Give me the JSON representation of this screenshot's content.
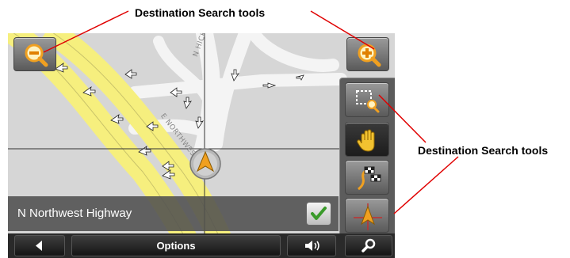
{
  "callouts": {
    "top": "Destination Search tools",
    "right": "Destination Search tools"
  },
  "map": {
    "street_labels": [
      "N HICKORY",
      "E NORTHWEST HWY"
    ]
  },
  "buttons": {
    "zoom_out_icon": "zoom-out-magnifier-icon",
    "zoom_in_icon": "zoom-in-magnifier-icon",
    "tools": [
      {
        "icon": "area-select-icon"
      },
      {
        "icon": "hand-pan-icon",
        "active": true
      },
      {
        "icon": "route-flags-icon"
      },
      {
        "icon": "current-position-icon"
      }
    ]
  },
  "street_bar": {
    "name": "N Northwest Highway",
    "confirm_icon": "checkmark-icon"
  },
  "bottom_bar": {
    "options_label": "Options",
    "back_icon": "left-arrow-icon",
    "volume_icon": "speaker-icon",
    "search_icon": "magnifier-icon"
  },
  "colors": {
    "highway": "#f6ef7e",
    "road": "#f4f4f4",
    "map_bg": "#d6d6d6",
    "accent_orange": "#f0a020",
    "confirm_green": "#3a9a2a",
    "callout_line": "#e00000"
  }
}
